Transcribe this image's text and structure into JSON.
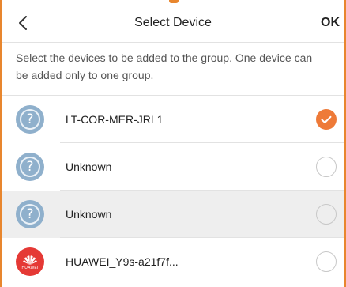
{
  "header": {
    "title": "Select Device",
    "ok_label": "OK"
  },
  "description": "Select the devices to be added to the group. One device can be added only to one group.",
  "devices": [
    {
      "name": "LT-COR-MER-JRL1",
      "icon": "unknown-device-icon",
      "selected": true
    },
    {
      "name": "Unknown",
      "icon": "unknown-device-icon",
      "selected": false
    },
    {
      "name": "Unknown",
      "icon": "unknown-device-icon",
      "selected": false
    },
    {
      "name": "HUAWEI_Y9s-a21f7f...",
      "icon": "huawei-logo",
      "brand_text": "HUAWEI",
      "selected": false
    }
  ],
  "colors": {
    "accent": "#ee7a38",
    "unknown_avatar": "#8fb0cc",
    "huawei_red": "#e53935"
  }
}
